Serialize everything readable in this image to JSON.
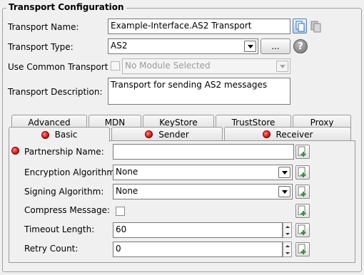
{
  "group": {
    "title": "Transport Configuration"
  },
  "fields": {
    "transport_name": {
      "label": "Transport Name:",
      "value": "Example-Interface.AS2 Transport"
    },
    "transport_type": {
      "label": "Transport Type:",
      "value": "AS2",
      "more_button": "..."
    },
    "use_common": {
      "label": "Use Common Transport",
      "value": "No Module Selected"
    },
    "description": {
      "label": "Transport Description:",
      "value": "Transport for sending AS2 messages"
    }
  },
  "tabs": {
    "back_row": [
      "Advanced",
      "MDN",
      "KeyStore",
      "TrustStore",
      "Proxy"
    ],
    "front_row": [
      "Basic",
      "Sender",
      "Receiver"
    ],
    "active": "Basic"
  },
  "basic": {
    "partnership_name": {
      "label": "Partnership Name:",
      "value": ""
    },
    "encryption": {
      "label": "Encryption Algorithm:",
      "value": "None"
    },
    "signing": {
      "label": "Signing Algorithm:",
      "value": "None"
    },
    "compress": {
      "label": "Compress Message:",
      "checked": false
    },
    "timeout": {
      "label": "Timeout Length:",
      "value": "60"
    },
    "retry": {
      "label": "Retry Count:",
      "value": "0"
    }
  },
  "colors": {
    "required": "#e01b1b",
    "add_plus": "#2a9a2a",
    "accent": "#2f6fbf"
  }
}
